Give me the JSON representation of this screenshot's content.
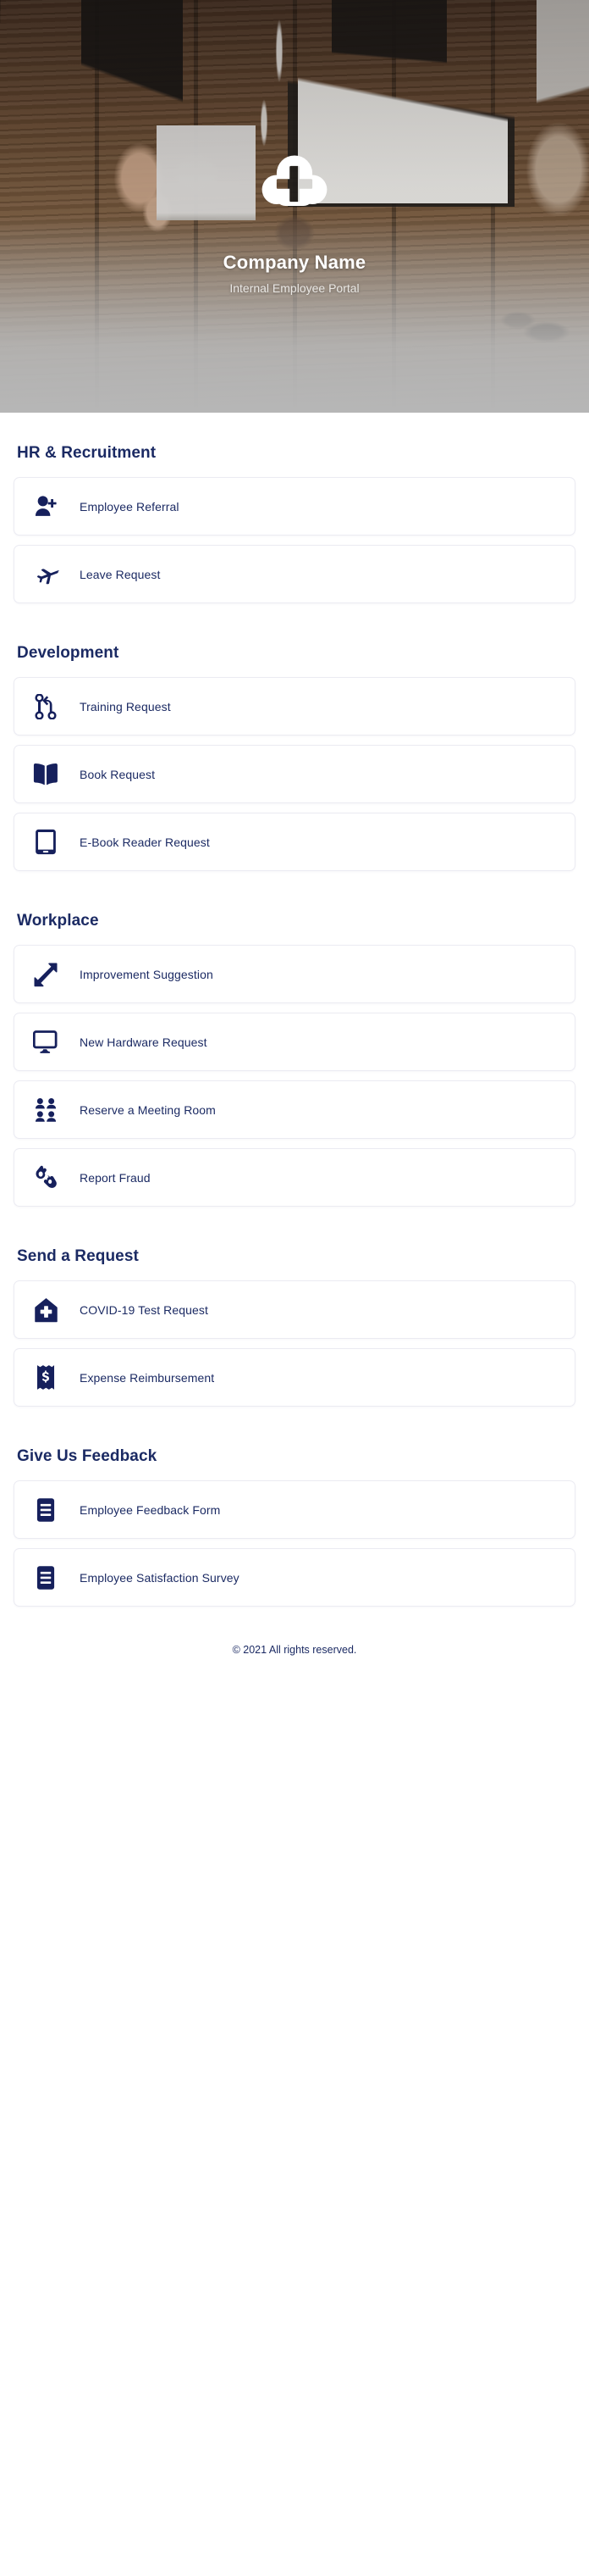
{
  "hero": {
    "logo_icon": "cloud-plus-icon",
    "title": "Company Name",
    "subtitle": "Internal Employee Portal"
  },
  "theme": {
    "navy": "#16205c",
    "text_navy": "#1b2a63",
    "card_border": "#ebebf2",
    "page_background": "#ffffff"
  },
  "sections": [
    {
      "title": "HR & Recruitment",
      "items": [
        {
          "label": "Employee Referral",
          "icon": "user-plus-icon"
        },
        {
          "label": "Leave Request",
          "icon": "airplane-icon"
        }
      ]
    },
    {
      "title": "Development",
      "items": [
        {
          "label": "Training Request",
          "icon": "code-branch-icon"
        },
        {
          "label": "Book Request",
          "icon": "open-book-icon"
        },
        {
          "label": "E-Book Reader Request",
          "icon": "tablet-icon"
        }
      ]
    },
    {
      "title": "Workplace",
      "items": [
        {
          "label": "Improvement Suggestion",
          "icon": "expand-arrows-icon"
        },
        {
          "label": "New Hardware Request",
          "icon": "desktop-monitor-icon"
        },
        {
          "label": "Reserve a Meeting Room",
          "icon": "users-group-icon"
        },
        {
          "label": "Report Fraud",
          "icon": "sign-language-hands-icon"
        }
      ]
    },
    {
      "title": "Send a Request",
      "items": [
        {
          "label": "COVID-19 Test Request",
          "icon": "house-medical-icon"
        },
        {
          "label": "Expense Reimbursement",
          "icon": "receipt-dollar-icon"
        }
      ]
    },
    {
      "title": "Give Us Feedback",
      "items": [
        {
          "label": "Employee Feedback Form",
          "icon": "form-lines-icon"
        },
        {
          "label": "Employee Satisfaction Survey",
          "icon": "form-lines-icon"
        }
      ]
    }
  ],
  "footer": {
    "copyright": "© 2021 All rights reserved."
  }
}
